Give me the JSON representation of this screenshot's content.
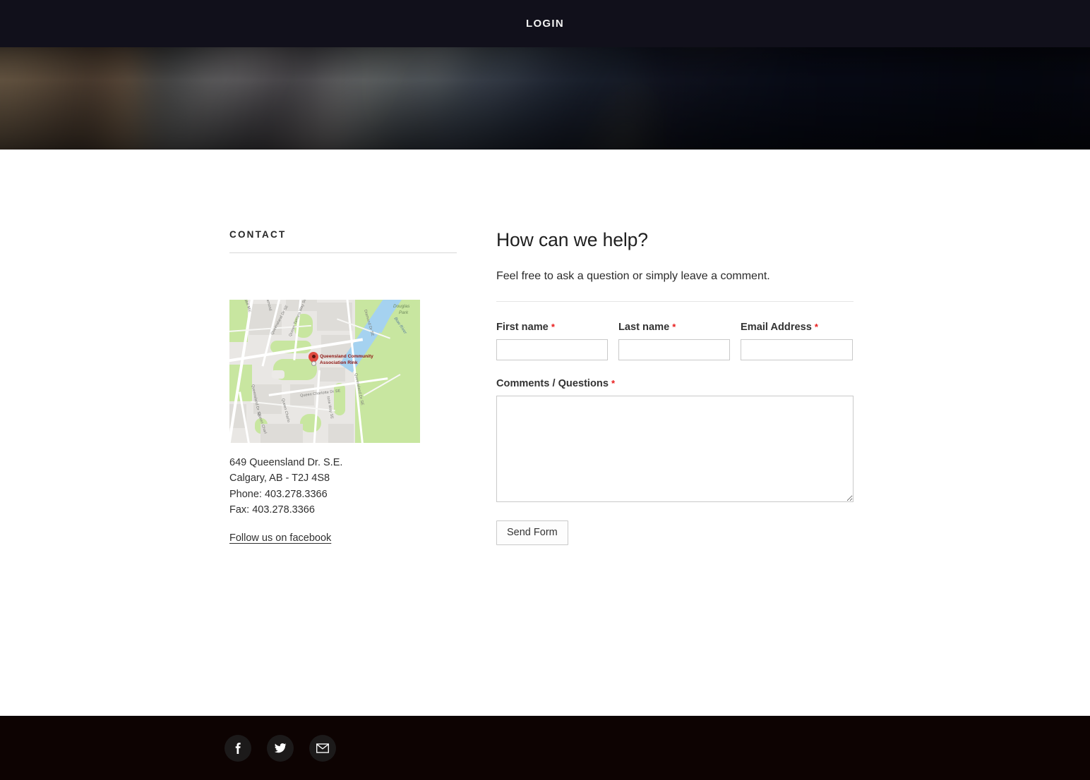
{
  "nav": {
    "login_label": "LOGIN"
  },
  "hero": {
    "alt": "blurred dark arena photo banner"
  },
  "sidebar": {
    "title": "CONTACT",
    "map": {
      "marker_label": "Queensland Community\nAssociation Rink",
      "marker_label_line1": "Queensland Community",
      "marker_label_line2": "Association Rink",
      "labels": [
        "Lake Mic",
        "Diamond",
        "Queensland Dr SE",
        "Queen Tamara Way SE",
        "Diamond Dr SE",
        "Queen Charlotte Dr SE",
        "Queensland Dr SE",
        "Queensland Dr SE",
        "Queen Charlo",
        "tone Way SE",
        "Queen Charl"
      ],
      "park_label": "Douglas\nPark",
      "park_label_line1": "Douglas",
      "park_label_line2": "Park",
      "water_label": "Bow River"
    },
    "address": {
      "street": "649 Queensland Dr. S.E.",
      "city": "Calgary, AB - T2J 4S8",
      "phone": "Phone: 403.278.3366",
      "fax": "Fax: 403.278.3366"
    },
    "facebook_link": "Follow us on facebook"
  },
  "form": {
    "title": "How can we help?",
    "subtitle": "Feel free to ask a question or simply leave a comment.",
    "required_mark": "*",
    "fields": {
      "first_name": {
        "label": "First name",
        "value": "",
        "placeholder": ""
      },
      "last_name": {
        "label": "Last name",
        "value": "",
        "placeholder": ""
      },
      "email": {
        "label": "Email Address",
        "value": "",
        "placeholder": ""
      },
      "comments": {
        "label": "Comments / Questions",
        "value": "",
        "placeholder": ""
      }
    },
    "submit_label": "Send Form"
  },
  "footer": {
    "social": [
      {
        "name": "facebook",
        "icon": "facebook-icon"
      },
      {
        "name": "twitter",
        "icon": "twitter-icon"
      },
      {
        "name": "email",
        "icon": "envelope-icon"
      }
    ]
  },
  "colors": {
    "nav_bg": "#11101b",
    "footer_bg": "#0d0302",
    "required_red": "#e81c1c",
    "text": "#2e2e2e",
    "border": "#c9c9c9",
    "map_marker": "#e04a40",
    "map_water": "#a5d2f0",
    "map_green": "#c8e6a0"
  }
}
